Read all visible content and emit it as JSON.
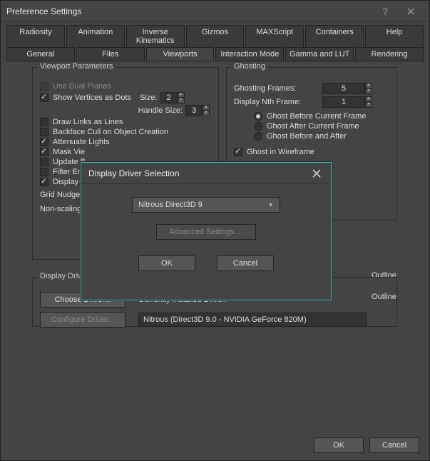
{
  "window": {
    "title": "Preference Settings"
  },
  "tabs_row1": [
    "Radiosity",
    "Animation",
    "Inverse Kinematics",
    "Gizmos",
    "MAXScript",
    "Containers",
    "Help"
  ],
  "tabs_row2": [
    "General",
    "Files",
    "Viewports",
    "Interaction Mode",
    "Gamma and LUT",
    "Rendering"
  ],
  "active_tab": "Viewports",
  "vp_params": {
    "title": "Viewport Parameters",
    "use_dual_planes": "Use Dual Planes",
    "show_vertices": "Show Vertices as Dots",
    "size_label": "Size:",
    "size_value": "2",
    "handle_size_label": "Handle Size:",
    "handle_size_value": "3",
    "draw_links": "Draw Links as Lines",
    "backface": "Backface Cull on Object Creation",
    "attenuate": "Attenuate Lights",
    "mask": "Mask Vie",
    "update": "Update B",
    "filter": "Filter Env",
    "display_w": "Display W",
    "grid_nudge": "Grid Nudge",
    "non_scaling": "Non-scaling"
  },
  "ghosting": {
    "title": "Ghosting",
    "frames_label": "Ghosting Frames:",
    "frames_value": "5",
    "nth_label": "Display Nth Frame:",
    "nth_value": "1",
    "before_current": "Ghost Before Current Frame",
    "after_current": "Ghost After Current Frame",
    "before_after": "Ghost Before and After",
    "wireframe": "Ghost in Wireframe"
  },
  "outline1": "Outline",
  "outline2": "Outline",
  "display_drivers": {
    "title": "Display Drivers",
    "choose": "Choose Driver...",
    "configure": "Configure Driver...",
    "installed_label": "Currently Installed Driver:",
    "installed_value": "Nitrous (Direct3D 9.0 - NVIDIA GeForce 820M)"
  },
  "footer": {
    "ok": "OK",
    "cancel": "Cancel"
  },
  "modal": {
    "title": "Display Driver Selection",
    "dropdown_value": "Nitrous Direct3D 9",
    "advanced": "Advanced Settings ...",
    "ok": "OK",
    "cancel": "Cancel"
  }
}
